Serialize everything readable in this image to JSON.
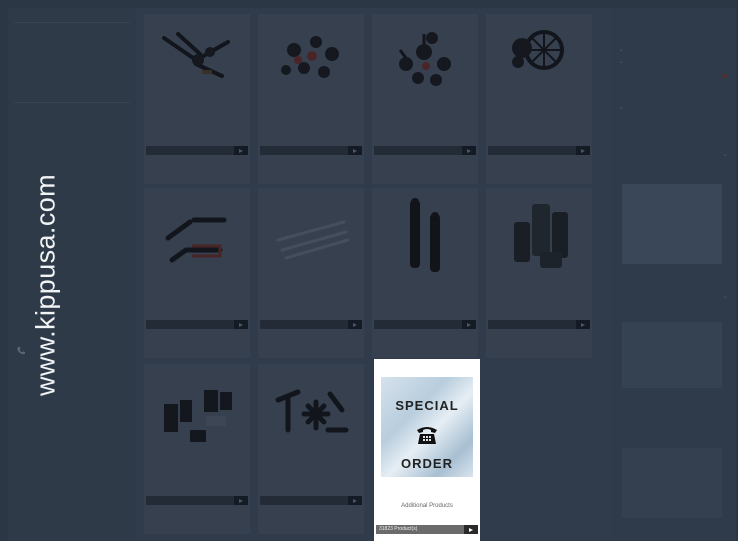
{
  "sidebar": {
    "items": [
      "",
      "",
      "",
      "",
      "",
      "",
      "",
      "",
      "",
      "",
      "",
      "",
      "",
      "",
      "",
      "",
      "",
      "",
      "",
      "",
      "",
      "",
      "",
      "",
      "",
      "",
      "",
      ""
    ],
    "phone": ""
  },
  "products": [
    {
      "name": "",
      "count": ""
    },
    {
      "name": "",
      "count": ""
    },
    {
      "name": "",
      "count": ""
    },
    {
      "name": "",
      "count": ""
    },
    {
      "name": "",
      "count": ""
    },
    {
      "name": "",
      "count": ""
    },
    {
      "name": "",
      "count": ""
    },
    {
      "name": "",
      "count": ""
    },
    {
      "name": "",
      "count": ""
    },
    {
      "name": "",
      "count": ""
    }
  ],
  "special_order": {
    "line1": "SPECIAL",
    "line2": "ORDER",
    "name": "Additional Products",
    "count": "31823 Product(s)"
  },
  "right_column": {
    "section1": "",
    "section2": "",
    "section3": "",
    "section4": ""
  },
  "watermark": "www.kippusa.com",
  "colors": {
    "overlay": "#303c4b",
    "highlight_card": "#ffffff",
    "button_bar": "#6b6b6b"
  },
  "icons": [
    "phone-icon",
    "arrow-right-icon",
    "telephone-icon"
  ]
}
